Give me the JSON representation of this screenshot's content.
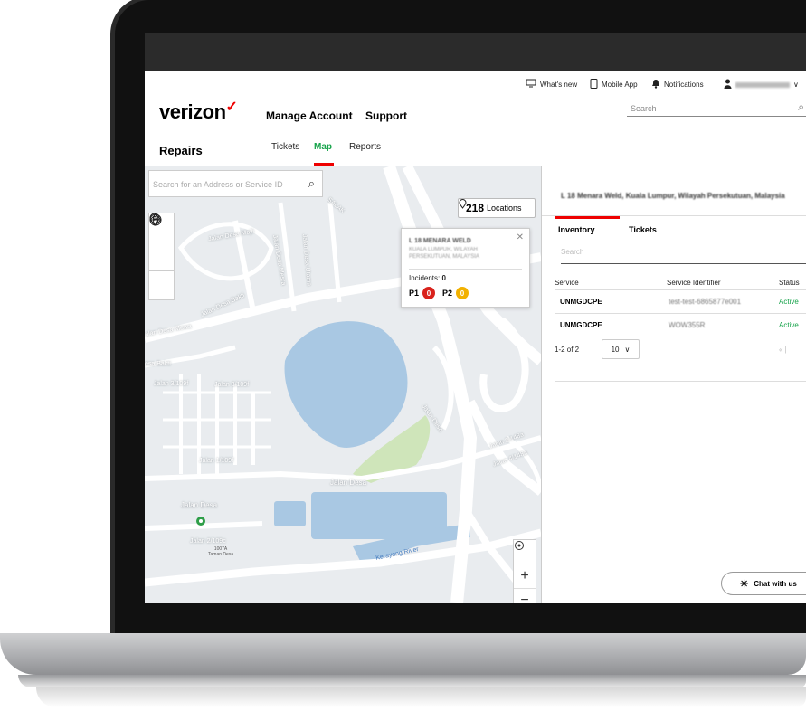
{
  "utility_bar": {
    "whats_new": "What's new",
    "mobile_app": "Mobile App",
    "notifications": "Notifications",
    "user_menu_chevron": "∨"
  },
  "header": {
    "logo": "verizon",
    "logo_mark": "✓",
    "nav": [
      "Manage Account",
      "Support"
    ],
    "search_placeholder": "Search"
  },
  "subnav": {
    "title": "Repairs",
    "tabs": [
      "Tickets",
      "Map",
      "Reports"
    ],
    "active_tab": "Map"
  },
  "map": {
    "search_placeholder": "Search for an Address or Service ID",
    "locations_count": "218",
    "locations_label": "Locations",
    "tools": [
      "globe-icon",
      "pin-icon",
      "directions-icon"
    ],
    "popup": {
      "title": "L 18 MENARA WELD",
      "subtitle_line1": "KUALA LUMPUR, WILAYAH",
      "subtitle_line2": "PERSEKUTUAN, MALAYSIA",
      "incidents_label": "Incidents:",
      "incidents_value": "0",
      "p1_label": "P1",
      "p1_value": "0",
      "p2_label": "P2",
      "p2_value": "0"
    },
    "labels": {
      "jalan_desa_main": "Jalan Desa",
      "jalan_desa_lower": "Jalan Desa",
      "jalan_desa_bakti": "Jalan Desa Bakti",
      "desa_bakti": "esa Bakti",
      "jalan_desa_mewa": "alan Desa Mewa",
      "jalan_3_109f_a": "Jalan 3/109f",
      "jalan_3_109f_b": "Jalan 3/109f",
      "jalan_1_109f": "Jalan 1/109f",
      "jalan_2_109c": "Jalan 2/109c",
      "kerayong_river": "Kerayong River",
      "jalan_desa_right": "Jalan Desa",
      "jalan_2_148a": "Jalan 2/148a",
      "jalan_4_148a": "Jalan 4/148a",
      "jalan_desa_majlis": "Jalan Desa Majli",
      "jalan_desa_mesra": "Jalan Desa Mesra",
      "jalan_desa_utama": "Jalan Desa Utama",
      "salak": "SALAK",
      "taman_desa": "1007A\nTaman Desa"
    },
    "zoom_in": "+",
    "zoom_out": "−"
  },
  "panel": {
    "address": "L 18 Menara Weld, Kuala Lumpur, Wilayah Persekutuan, Malaysia",
    "tabs": [
      "Inventory",
      "Tickets"
    ],
    "active_tab": "Inventory",
    "search_placeholder": "Search",
    "columns": [
      "Service",
      "Service Identifier",
      "Status"
    ],
    "rows": [
      {
        "service": "UNMGDCPE",
        "identifier": "test-test-6865877e001",
        "status": "Active"
      },
      {
        "service": "UNMGDCPE",
        "identifier": "WOW355R",
        "status": "Active"
      }
    ],
    "pagination_range": "1-2 of 2",
    "page_size": "10",
    "pager_nav": "« |"
  },
  "chat": {
    "label": "Chat with us"
  },
  "colors": {
    "brand_red": "#ee0000",
    "p1": "#d9221c",
    "p2": "#f2b100",
    "active_status": "#16a34a"
  }
}
